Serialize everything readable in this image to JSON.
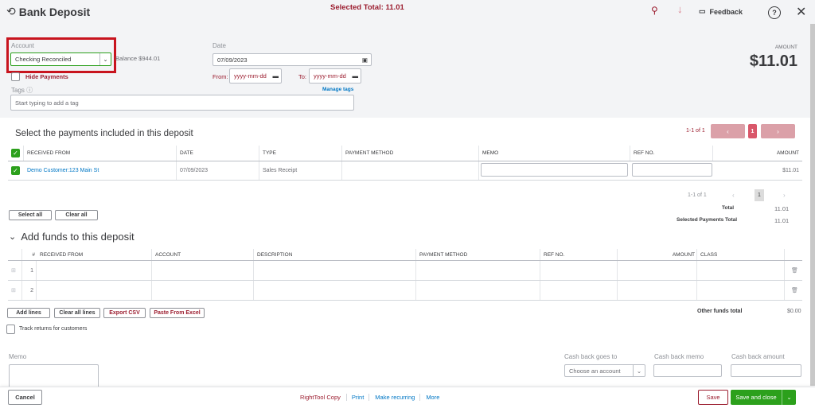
{
  "header": {
    "title": "Bank Deposit",
    "selected_total": "Selected Total: 11.01",
    "feedback": "Feedback",
    "amount_label": "AMOUNT",
    "amount": "$11.01"
  },
  "form": {
    "account_label": "Account",
    "account_value": "Checking Reconciled",
    "balance": "Balance $944.01",
    "hide_payments": "Hide Payments",
    "date_label": "Date",
    "date_value": "07/09/2023",
    "from_label": "From:",
    "to_label": "To:",
    "date_placeholder": "yyyy-mm-dd",
    "tags_label": "Tags",
    "manage_tags": "Manage tags",
    "tags_placeholder": "Start typing to add a tag"
  },
  "payments": {
    "title": "Select the payments included in this deposit",
    "pagination": "1-1 of 1",
    "page": "1",
    "columns": [
      "RECEIVED FROM",
      "DATE",
      "TYPE",
      "PAYMENT METHOD",
      "MEMO",
      "REF NO.",
      "AMOUNT"
    ],
    "rows": [
      {
        "received_from": "Demo Customer:123 Main St",
        "date": "07/09/2023",
        "type": "Sales Receipt",
        "payment_method": "",
        "amount": "$11.01",
        "checked": true
      }
    ],
    "bottom_pagination": "1-1 of 1",
    "bottom_page": "1",
    "prev": "‹",
    "next": "›",
    "total_label": "Total",
    "total": "11.01",
    "selected_total_label": "Selected Payments Total",
    "selected_total": "11.01",
    "select_all": "Select all",
    "clear_all": "Clear all"
  },
  "funds": {
    "title": "Add funds to this deposit",
    "columns": [
      "#",
      "RECEIVED FROM",
      "ACCOUNT",
      "DESCRIPTION",
      "PAYMENT METHOD",
      "REF NO.",
      "AMOUNT",
      "CLASS"
    ],
    "rows": [
      {
        "num": "1"
      },
      {
        "num": "2"
      }
    ],
    "add_lines": "Add lines",
    "clear_all_lines": "Clear all lines",
    "export_csv": "Export CSV",
    "paste_excel": "Paste From Excel",
    "other_total_label": "Other funds total",
    "other_total": "$0.00",
    "track_returns": "Track returns for customers"
  },
  "bottom": {
    "memo_label": "Memo",
    "cash_back_goes_to": "Cash back goes to",
    "cash_back_placeholder": "Choose an account",
    "cash_back_memo": "Cash back memo",
    "cash_back_amount": "Cash back amount"
  },
  "footer": {
    "cancel": "Cancel",
    "righttool_copy": "RightTool Copy",
    "print": "Print",
    "make_recurring": "Make recurring",
    "more": "More",
    "save": "Save",
    "save_close": "Save and close"
  },
  "colors": {
    "accent_red": "#9b1c2e",
    "green": "#2ca01c",
    "link": "#0077c5",
    "pager": "#d9808d"
  }
}
